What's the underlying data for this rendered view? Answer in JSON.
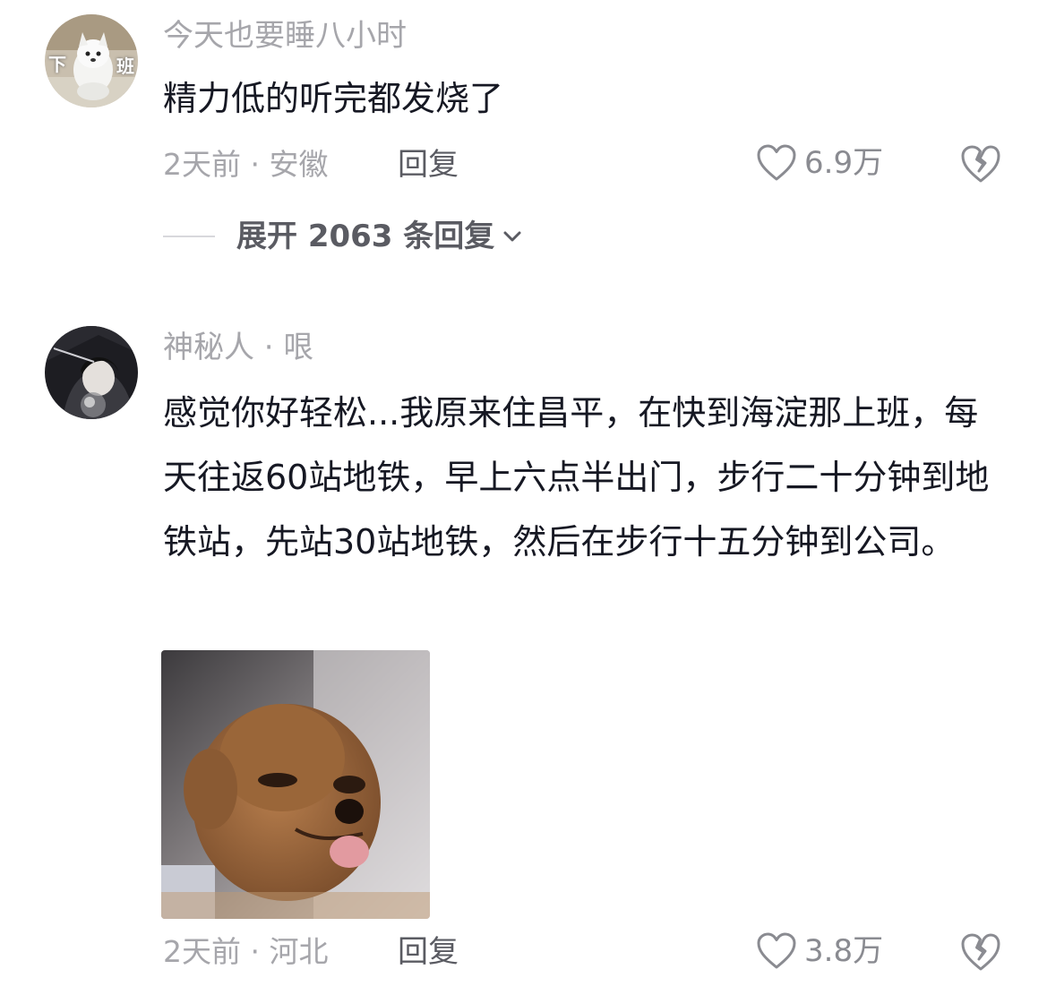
{
  "comments": [
    {
      "username": "今天也要睡八小时",
      "content": "精力低的听完都发烧了",
      "meta": "2天前 · 安徽",
      "reply_label": "回复",
      "like_count": "6.9万",
      "expand_label": "展开 2063 条回复",
      "avatar_badge_left": "下",
      "avatar_badge_right": "班"
    },
    {
      "username": "神秘人 · 哏",
      "content": "感觉你好轻松...我原来住昌平，在快到海淀那上班，每天往返60站地铁，早上六点半出门，步行二十分钟到地铁站，先站30站地铁，然后在步行十五分钟到公司。",
      "meta": "2天前 · 河北",
      "reply_label": "回复",
      "like_count": "3.8万"
    }
  ],
  "icons": {
    "like": "heart-outline-icon",
    "dislike": "broken-heart-icon",
    "expand": "chevron-down-icon"
  },
  "colors": {
    "text_primary": "#161823",
    "text_secondary": "#a6a6ab",
    "action_text": "#5a5b62",
    "icon_gray": "#8a8b91"
  }
}
